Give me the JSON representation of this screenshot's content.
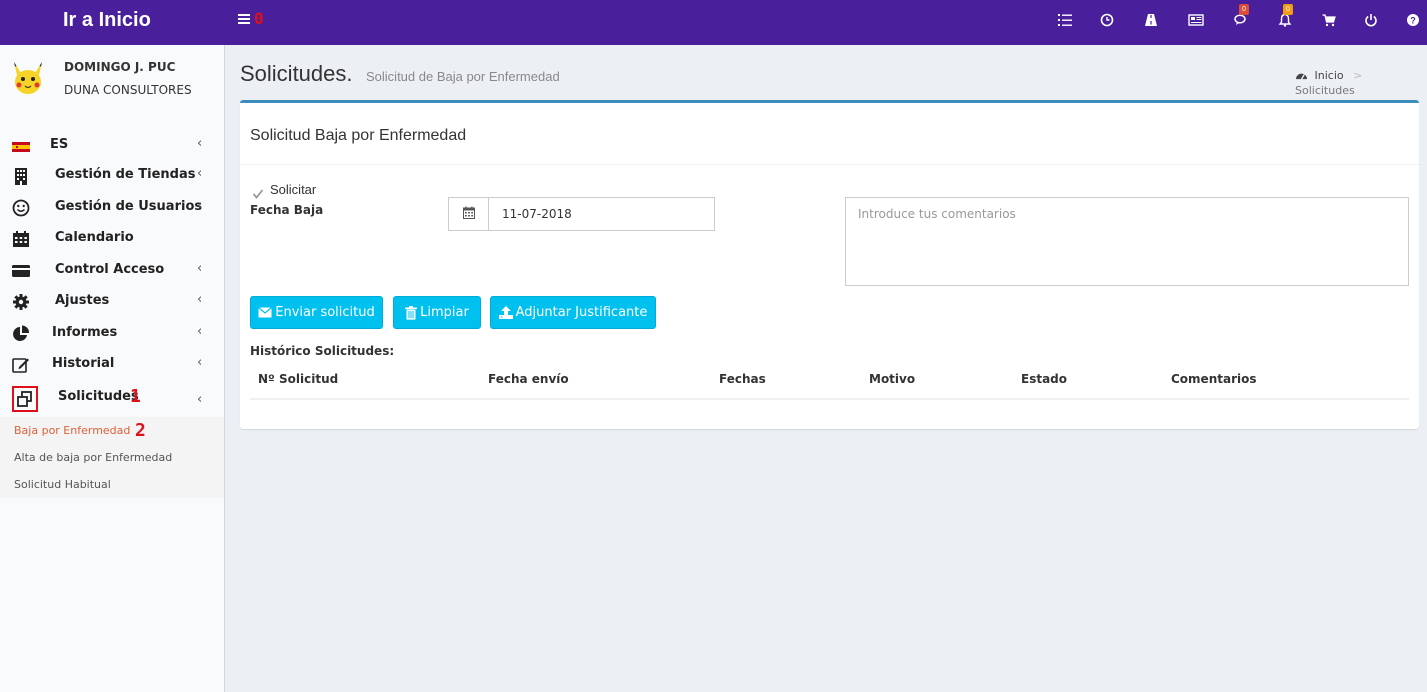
{
  "header": {
    "brand": "Ir a Inicio",
    "toggle_count": "0",
    "icons": [
      "list-icon",
      "clock-icon",
      "road-icon",
      "newspaper-icon",
      "comments-icon",
      "bell-icon",
      "cart-icon",
      "power-icon",
      "question-icon"
    ],
    "comments_badge": "0",
    "notifications_badge": "0",
    "colors": {
      "bar": "#4a1f9c",
      "annotation": "#e0101a"
    }
  },
  "user": {
    "name": "DOMINGO J. PUC",
    "company": "DUNA CONSULTORES"
  },
  "sidebar": {
    "items": [
      {
        "label": "ES",
        "icon": "spain-flag-icon"
      },
      {
        "label": "Gestión de Tiendas",
        "icon": "building-icon"
      },
      {
        "label": "Gestión de Usuarios",
        "icon": "smile-icon"
      },
      {
        "label": "Calendario",
        "icon": "calendar-icon"
      },
      {
        "label": "Control Acceso",
        "icon": "credit-card-icon"
      },
      {
        "label": "Ajustes",
        "icon": "gear-icon"
      },
      {
        "label": "Informes",
        "icon": "pie-chart-icon"
      },
      {
        "label": "Historial",
        "icon": "edit-icon"
      },
      {
        "label": "Solicitudes",
        "icon": "clone-icon"
      }
    ],
    "annotation_1": "1",
    "annotation_2": "2",
    "submenu": [
      {
        "label": "Baja por Enfermedad",
        "active": true
      },
      {
        "label": "Alta de baja por Enfermedad",
        "active": false
      },
      {
        "label": "Solicitud Habitual",
        "active": false
      }
    ]
  },
  "page": {
    "title": "Solicitudes.",
    "subtitle": "Solicitud de Baja por Enfermedad",
    "breadcrumb": {
      "home": "Inicio",
      "current": "Solicitudes"
    }
  },
  "form": {
    "box_title": "Solicitud Baja por Enfermedad",
    "checkbox_label": "Solicitar",
    "fecha_label": "Fecha Baja",
    "fecha_value": "11-07-2018",
    "comments_placeholder": "Introduce tus comentarios",
    "buttons": {
      "send": "Enviar solicitud",
      "clear": "Limpiar",
      "attach": "Adjuntar Justificante"
    },
    "history_label": "Histórico Solicitudes:",
    "columns": [
      "Nº Solicitud",
      "Fecha envío",
      "Fechas",
      "Motivo",
      "Estado",
      "Comentarios"
    ]
  }
}
